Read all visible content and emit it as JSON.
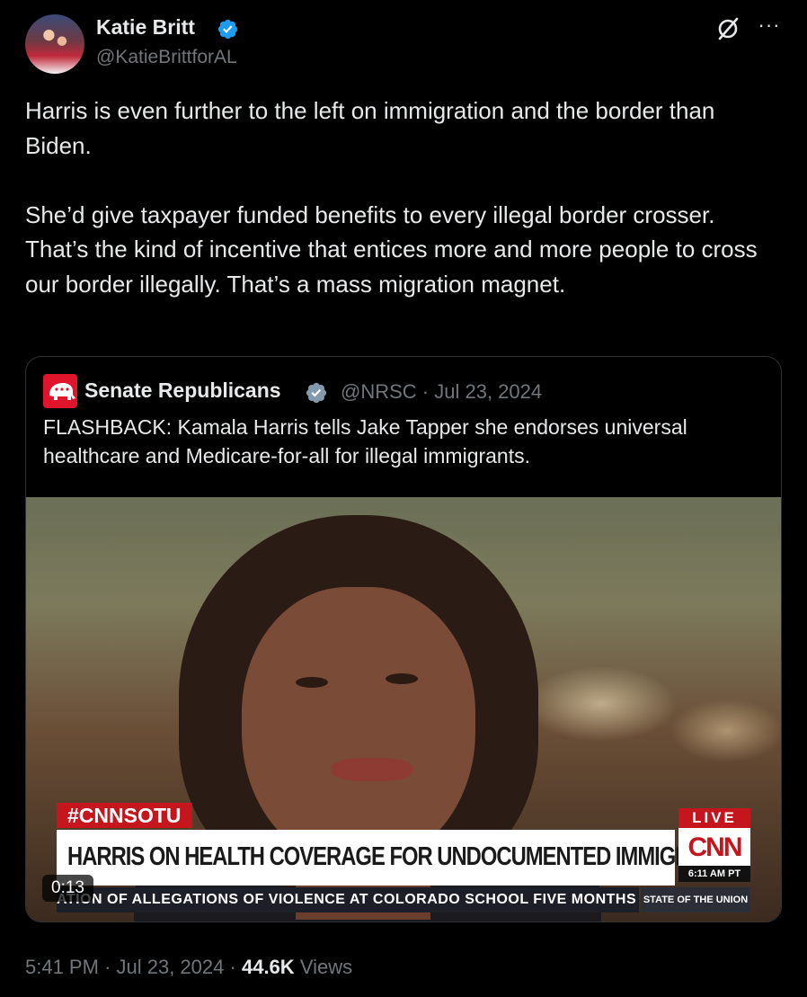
{
  "tweet": {
    "author_name": "Katie Britt",
    "author_handle": "@KatieBrittforAL",
    "text": "Harris is even further to the left on immigration and the border than Biden.\n\nShe’d give taxpayer funded benefits to every illegal border crosser. That’s the kind of incentive that entices more and more people to cross our border illegally. That’s a mass migration magnet.",
    "more_label": "···"
  },
  "quote": {
    "author_name": "Senate Republicans",
    "author_handle": "@NRSC",
    "separator": "·",
    "date": "Jul 23, 2024",
    "text": "FLASHBACK: Kamala Harris tells Jake Tapper she endorses universal healthcare and Medicare-for-all for illegal immigrants."
  },
  "video": {
    "hashtag": "#CNNSOTU",
    "headline": "HARRIS ON HEALTH COVERAGE FOR UNDOCUMENTED IMMIGRANTS",
    "live_label": "LIVE",
    "network_logo": "CNN",
    "network_time": "6:11 AM PT",
    "ticker": "ATION OF ALLEGATIONS OF VIOLENCE AT COLORADO SCHOOL FIVE MONTHS",
    "show_name": "STATE OF THE UNION",
    "timer": "0:13"
  },
  "footer": {
    "time": "5:41 PM",
    "separator": "·",
    "date": "Jul 23, 2024",
    "views_count": "44.6K",
    "views_label": "Views"
  },
  "colors": {
    "background": "#000000",
    "text_primary": "#e7e9ea",
    "text_secondary": "#71767b",
    "verified_blue": "#1d9bf0",
    "border": "#2f3336",
    "cnn_red": "#c4161c"
  },
  "icons": [
    "verified-badge-icon",
    "grok-icon",
    "more-icon",
    "gop-elephant-icon"
  ]
}
